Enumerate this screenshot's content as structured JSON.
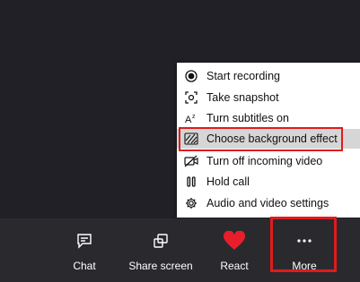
{
  "menu": {
    "items": [
      {
        "label": "Start recording",
        "icon": "record-icon"
      },
      {
        "label": "Take snapshot",
        "icon": "snapshot-icon"
      },
      {
        "label": "Turn subtitles on",
        "icon": "subtitles-icon"
      },
      {
        "label": "Choose background effect",
        "icon": "background-effect-icon",
        "selected": true
      },
      {
        "label": "Turn off incoming video",
        "icon": "video-off-icon"
      },
      {
        "label": "Hold call",
        "icon": "pause-icon"
      },
      {
        "label": "Audio and video settings",
        "icon": "gear-icon"
      }
    ]
  },
  "toolbar": {
    "chat_label": "Chat",
    "share_label": "Share screen",
    "react_label": "React",
    "more_label": "More"
  },
  "colors": {
    "highlight": "#e01b1b",
    "react_heart": "#e81e2b",
    "bar_bg": "#2a2a2e",
    "stage_bg": "#202026"
  }
}
